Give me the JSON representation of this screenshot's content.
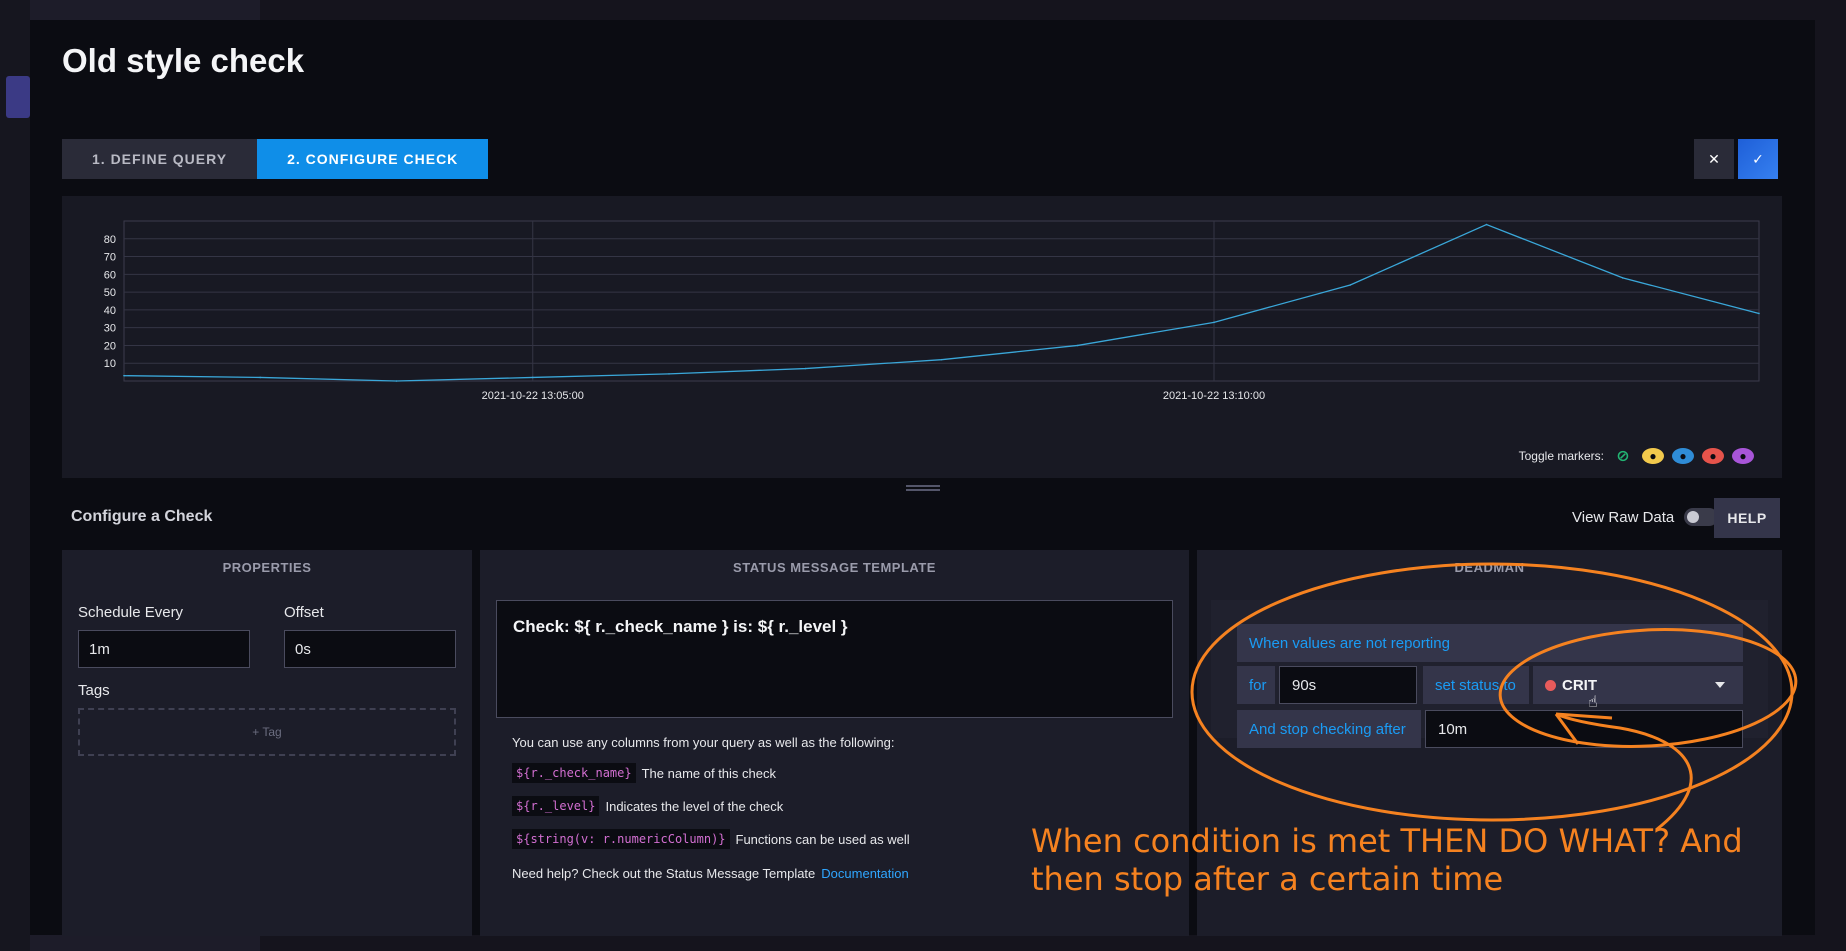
{
  "page_title": "Old style check",
  "tabs": [
    {
      "label": "1. DEFINE QUERY",
      "active": false
    },
    {
      "label": "2. CONFIGURE CHECK",
      "active": true
    }
  ],
  "header_icons": {
    "close": "close-icon",
    "save": "check-icon"
  },
  "chart_data": {
    "type": "line",
    "x": [
      "2021-10-22 13:02:00",
      "2021-10-22 13:03:00",
      "2021-10-22 13:04:00",
      "2021-10-22 13:05:00",
      "2021-10-22 13:06:00",
      "2021-10-22 13:07:00",
      "2021-10-22 13:08:00",
      "2021-10-22 13:09:00",
      "2021-10-22 13:10:00",
      "2021-10-22 13:11:00",
      "2021-10-22 13:12:00",
      "2021-10-22 13:13:00",
      "2021-10-22 13:14:00"
    ],
    "values": [
      3,
      2,
      0,
      2,
      4,
      7,
      12,
      20,
      33,
      54,
      88,
      58,
      38
    ],
    "ylim": [
      0,
      90
    ],
    "y_ticks": [
      10,
      20,
      30,
      40,
      50,
      60,
      70,
      80
    ],
    "x_tick_labels": [
      "2021-10-22 13:05:00",
      "2021-10-22 13:10:00"
    ],
    "series_color": "#3aa7d9",
    "grid": true
  },
  "toggle_markers": {
    "label": "Toggle markers:",
    "markers": [
      {
        "name": "marker-ok-hidden",
        "color": "#22b573",
        "icon": "eye-slash-icon"
      },
      {
        "name": "marker-info",
        "color": "#f2c94c",
        "icon": "eye-icon"
      },
      {
        "name": "marker-warn",
        "color": "#2f8cd6",
        "icon": "eye-icon"
      },
      {
        "name": "marker-crit",
        "color": "#e5534b",
        "icon": "eye-icon"
      },
      {
        "name": "marker-unknown",
        "color": "#a855d8",
        "icon": "eye-icon"
      }
    ]
  },
  "configure": {
    "title": "Configure a Check",
    "view_raw_label": "View Raw Data",
    "help_label": "HELP"
  },
  "properties": {
    "heading": "PROPERTIES",
    "schedule_label": "Schedule Every",
    "schedule_value": "1m",
    "offset_label": "Offset",
    "offset_value": "0s",
    "tags_label": "Tags",
    "add_tag_label": "+ Tag"
  },
  "status_template": {
    "heading": "STATUS MESSAGE TEMPLATE",
    "template": "Check: ${ r._check_name } is: ${ r._level }",
    "intro": "You can use any columns from your query as well as the following:",
    "vars": [
      {
        "code": "${r._check_name}",
        "desc": "The name of this check"
      },
      {
        "code": "${r._level}",
        "desc": "Indicates the level of the check"
      },
      {
        "code": "${string(v: r.numericColumn)}",
        "desc": "Functions can be used as well"
      }
    ],
    "help_text": "Need help? Check out the Status Message Template",
    "doc_link": "Documentation"
  },
  "deadman": {
    "heading": "DEADMAN",
    "when_label": "When values are not reporting",
    "for_label": "for",
    "for_value": "90s",
    "set_status_label": "set status to",
    "status_value": "CRIT",
    "stop_label": "And stop checking after",
    "stop_value": "10m"
  },
  "annotation": {
    "text": "When condition is met THEN DO WHAT?  And then stop after a certain time",
    "color": "#f58220"
  }
}
